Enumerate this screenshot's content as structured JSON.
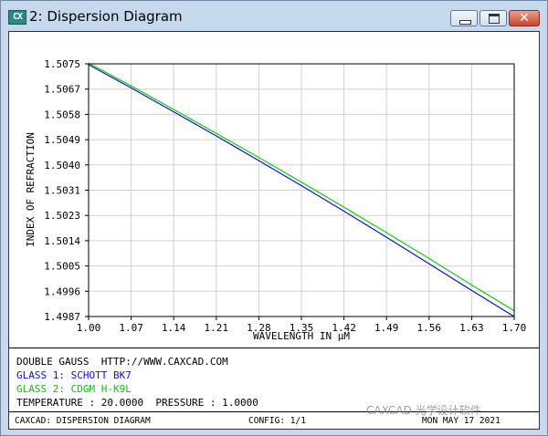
{
  "window": {
    "icon_text": "CX",
    "title": "2: Dispersion Diagram",
    "close_glyph": "✕"
  },
  "chart_data": {
    "type": "line",
    "xlabel": "WAVELENGTH IN μM",
    "ylabel": "INDEX OF REFRACTION",
    "xlim": [
      1.0,
      1.7
    ],
    "ylim": [
      1.4987,
      1.5075
    ],
    "x_ticks": [
      "1.00",
      "1.07",
      "1.14",
      "1.21",
      "1.28",
      "1.35",
      "1.42",
      "1.49",
      "1.56",
      "1.63",
      "1.70"
    ],
    "y_ticks": [
      "1.5075",
      "1.5067",
      "1.5058",
      "1.5049",
      "1.5040",
      "1.5031",
      "1.5023",
      "1.5014",
      "1.5005",
      "1.4996",
      "1.4987"
    ],
    "grid": true,
    "x": [
      1.0,
      1.07,
      1.14,
      1.21,
      1.28,
      1.35,
      1.42,
      1.49,
      1.56,
      1.63,
      1.7
    ],
    "series": [
      {
        "name": "GLASS 1: SCHOTT BK7",
        "color": "#1010d0",
        "values": [
          1.50747,
          1.50666,
          1.50583,
          1.50499,
          1.50413,
          1.50326,
          1.50237,
          1.50146,
          1.50054,
          1.49961,
          1.4987
        ]
      },
      {
        "name": "GLASS 2: CDGM H-K9L",
        "color": "#10d010",
        "values": [
          1.50753,
          1.50673,
          1.50591,
          1.50508,
          1.50424,
          1.50338,
          1.50251,
          1.50162,
          1.50072,
          1.4998,
          1.4989
        ]
      }
    ]
  },
  "info": {
    "line1": "DOUBLE GAUSS  HTTP://WWW.CAXCAD.COM",
    "line2": "GLASS 1: SCHOTT BK7",
    "line3": "GLASS 2: CDGM H-K9L",
    "line4": "TEMPERATURE : 20.0000  PRESSURE : 1.0000",
    "glass1_color": "#1010d0",
    "glass2_color": "#10c010"
  },
  "status": {
    "left": "CAXCAD: DISPERSION DIAGRAM",
    "config": "CONFIG: 1/1",
    "date": "MON MAY 17 2021"
  },
  "watermark": "CAXCAD 光学设计软件"
}
